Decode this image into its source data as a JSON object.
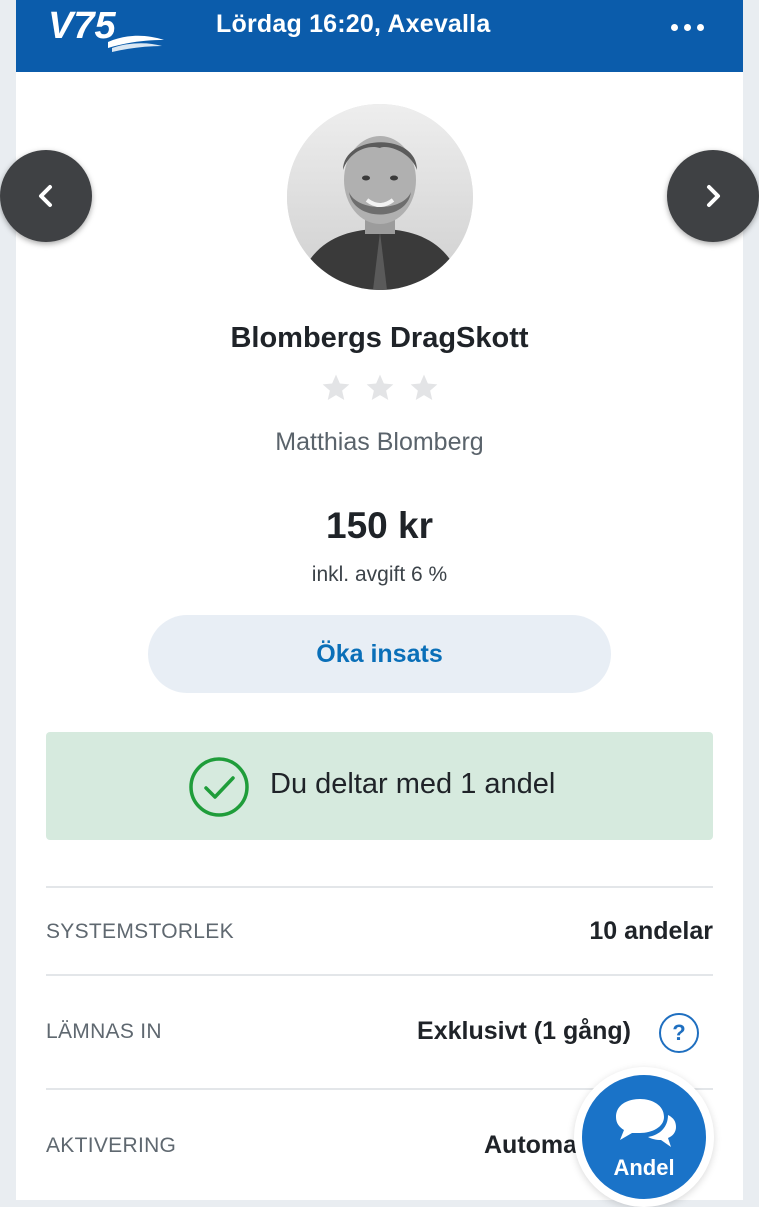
{
  "header": {
    "logo_text": "V75",
    "title": "Lördag 16:20, Axevalla"
  },
  "profile": {
    "team_name": "Blombergs DragSkott",
    "rating": 0,
    "rating_max": 3,
    "owner": "Matthias Blomberg"
  },
  "price": {
    "amount": "150 kr",
    "fee_note": "inkl. avgift 6 %"
  },
  "actions": {
    "increase_stake": "Öka insats"
  },
  "participation": {
    "message": "Du deltar med 1 andel"
  },
  "details": [
    {
      "label": "SYSTEMSTORLEK",
      "value": "10 andelar"
    },
    {
      "label": "LÄMNAS IN",
      "value": "Exklusivt (1 gång)"
    },
    {
      "label": "AKTIVERING",
      "value": "Automa"
    }
  ],
  "help": {
    "symbol": "?"
  },
  "fab": {
    "label": "Andel"
  },
  "colors": {
    "header": "#0b5cab",
    "accent": "#0a6fb8",
    "success_bg": "#d6eade",
    "success": "#1f9d3a",
    "fab": "#1a73c8"
  }
}
